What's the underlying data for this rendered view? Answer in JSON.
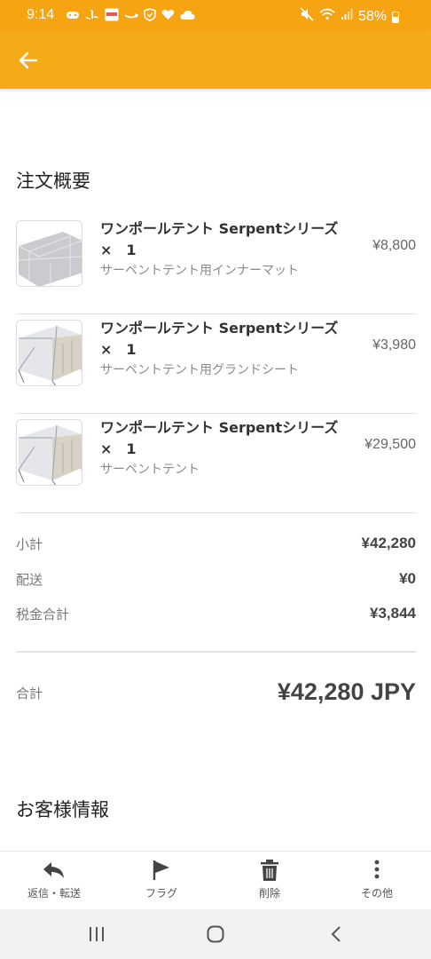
{
  "status_bar": {
    "time": "9:14",
    "battery": "58%",
    "notification_icons": [
      "game-icon",
      "playstation-icon",
      "app-icon",
      "amazon-icon",
      "shield-icon",
      "heart-icon",
      "cloud-icon"
    ],
    "system_icons": [
      "mute-icon",
      "wifi-icon",
      "signal-icon",
      "battery-icon"
    ]
  },
  "app_bar": {
    "back_icon": "arrow-left-icon",
    "color": "#f5ab18"
  },
  "order_summary": {
    "title": "注文概要",
    "items": [
      {
        "name": "ワンポールテント Serpentシリーズ　×　1",
        "variant": "サーペントテント用インナーマット",
        "price": "¥8,800",
        "thumb": "mat"
      },
      {
        "name": "ワンポールテント Serpentシリーズ　×　1",
        "variant": "サーペントテント用グランドシート",
        "price": "¥3,980",
        "thumb": "tent"
      },
      {
        "name": "ワンポールテント Serpentシリーズ　×　1",
        "variant": "サーペントテント",
        "price": "¥29,500",
        "thumb": "tent"
      }
    ],
    "subtotal_label": "小計",
    "subtotal": "¥42,280",
    "shipping_label": "配送",
    "shipping": "¥0",
    "tax_label": "税金合計",
    "tax": "¥3,844",
    "total_label": "合計",
    "total": "¥42,280 JPY"
  },
  "customer": {
    "title": "お客様情報"
  },
  "toolbar": {
    "reply_label": "返信・転送",
    "flag_label": "フラグ",
    "delete_label": "削除",
    "more_label": "その他"
  },
  "nav": {
    "recents_icon": "recents-icon",
    "home_icon": "home-icon",
    "back_icon": "back-icon"
  }
}
